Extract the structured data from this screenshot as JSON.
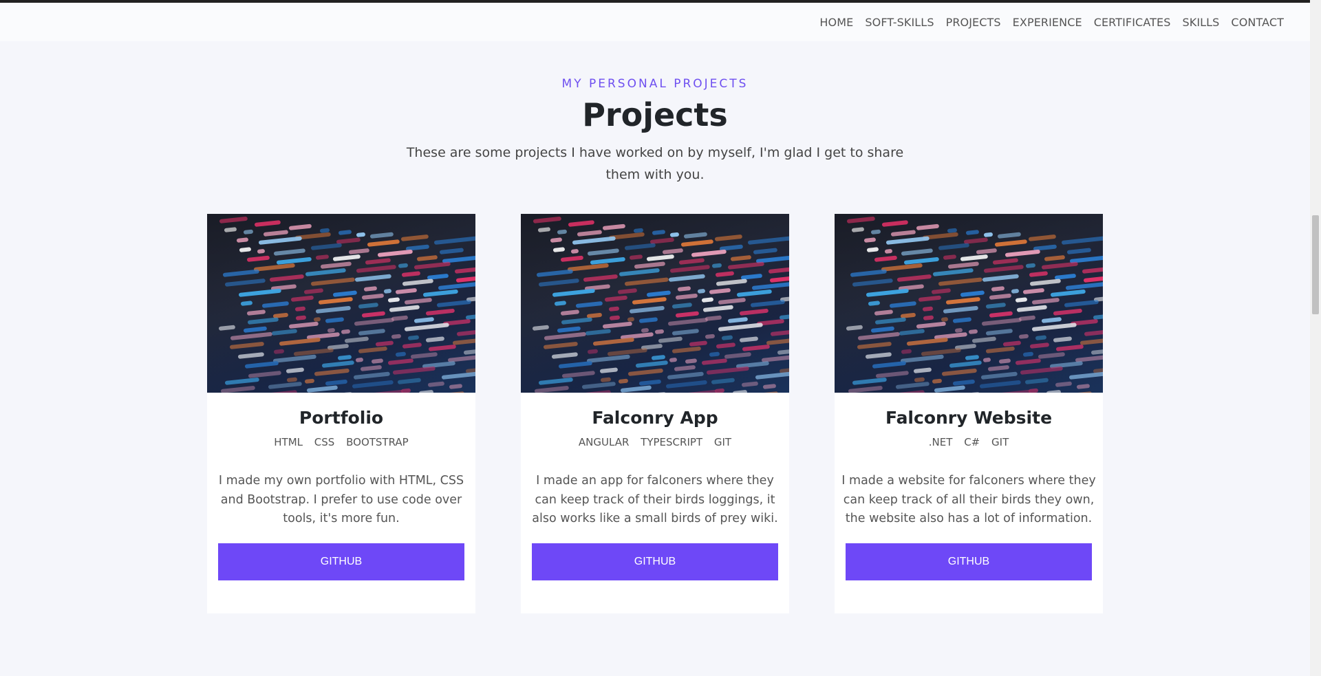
{
  "nav": {
    "items": [
      "HOME",
      "SOFT-SKILLS",
      "PROJECTS",
      "EXPERIENCE",
      "CERTIFICATES",
      "SKILLS",
      "CONTACT"
    ]
  },
  "section": {
    "eyebrow": "MY PERSONAL PROJECTS",
    "title": "Projects",
    "subtitle": "These are some projects I have worked on by myself, I'm glad I get to share them with you."
  },
  "cards": [
    {
      "title": "Portfolio",
      "tags": [
        "HTML",
        "CSS",
        "BOOTSTRAP"
      ],
      "description": "I made my own portfolio with HTML, CSS and Bootstrap. I prefer to use code over tools, it's more fun.",
      "button_label": "GITHUB",
      "image_icon": "code-screenshot-image"
    },
    {
      "title": "Falconry App",
      "tags": [
        "ANGULAR",
        "TYPESCRIPT",
        "GIT"
      ],
      "description": "I made an app for falconers where they can keep track of their birds loggings, it also works like a small birds of prey wiki.",
      "button_label": "GITHUB",
      "image_icon": "code-screenshot-image"
    },
    {
      "title": "Falconry Website",
      "tags": [
        ".NET",
        "C#",
        "GIT"
      ],
      "description": "I made a website for falconers where they can keep track of all their birds they own, the website also has a lot of information.",
      "button_label": "GITHUB",
      "image_icon": "code-screenshot-image"
    }
  ],
  "colors": {
    "accent": "#6e48f7",
    "eyebrow": "#6e4ff0",
    "page_bg": "#f5f6fb",
    "card_bg": "#ffffff"
  }
}
